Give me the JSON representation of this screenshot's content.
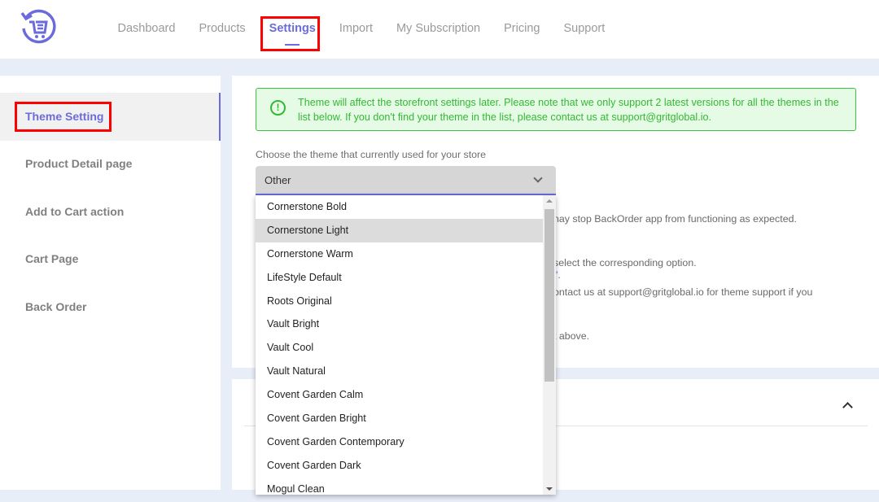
{
  "header": {
    "logo": "cart-return-logo",
    "nav": [
      "Dashboard",
      "Products",
      "Settings",
      "Import",
      "My Subscription",
      "Pricing",
      "Support"
    ],
    "active_nav": "Settings"
  },
  "sidebar": {
    "items": [
      "Theme Setting",
      "Product Detail page",
      "Add to Cart action",
      "Cart Page",
      "Back Order"
    ],
    "active": "Theme Setting"
  },
  "alert": {
    "icon": "exclamation-circle-icon",
    "text": "Theme will affect the storefront settings later. Please note that we only support 2 latest versions for all the themes in the list below. If you don't find your theme in the list, please contact us at support@gritglobal.io."
  },
  "theme_select": {
    "label": "Choose the theme that currently used for your store",
    "value": "Other",
    "options": [
      "Cornerstone Bold",
      "Cornerstone Light",
      "Cornerstone Warm",
      "LifeStyle Default",
      "Roots Original",
      "Vault Bright",
      "Vault Cool",
      "Vault Natural",
      "Covent Garden Calm",
      "Covent Garden Bright",
      "Covent Garden Contemporary",
      "Covent Garden Dark",
      "Mogul Clean"
    ],
    "hovered": "Cornerstone Light"
  },
  "occluded_text": {
    "line1": "nay stop BackOrder app from functioning as expected.",
    "line2": "select the corresponding option.",
    "line3": "'.",
    "line4": "ontact us at support@gritglobal.io for theme support if you",
    "line5": "t above."
  },
  "colors": {
    "accent": "#6b6bdc",
    "alert_green": "#33b833",
    "highlight_red": "#ff0000"
  }
}
